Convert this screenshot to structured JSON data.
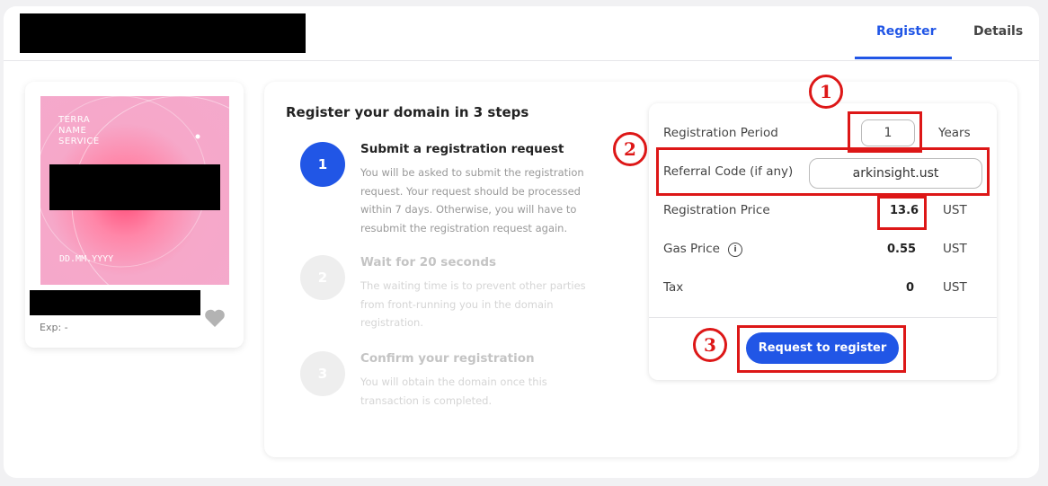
{
  "tabs": {
    "register": "Register",
    "details": "Details"
  },
  "nft": {
    "brand_line1": "TERRA",
    "brand_line2": "NAME",
    "brand_line3": "SERVICE",
    "date_placeholder": "DD.MM.YYYY",
    "exp": "Exp: -",
    "colors": {
      "art_center": "#ff4f7a",
      "art_edge": "#f4a9cc"
    }
  },
  "steps": {
    "title": "Register your domain in 3 steps",
    "items": [
      {
        "number": "1",
        "title": "Submit a registration request",
        "desc": "You will be asked to submit the registration request. Your request should be processed within 7 days. Otherwise, you will have to resubmit the registration request again."
      },
      {
        "number": "2",
        "title": "Wait for 20 seconds",
        "desc": "The waiting time is to prevent other parties from front-running you in the domain registration."
      },
      {
        "number": "3",
        "title": "Confirm your registration",
        "desc": "You will obtain the domain once this transaction is completed."
      }
    ]
  },
  "form": {
    "period_label": "Registration Period",
    "period_value": "1",
    "period_unit": "Years",
    "referral_label": "Referral Code (if any)",
    "referral_value": "arkinsight.ust",
    "price_label": "Registration Price",
    "price_value": "13.6",
    "price_unit": "UST",
    "gas_label": "Gas Price",
    "gas_value": "0.55",
    "gas_unit": "UST",
    "tax_label": "Tax",
    "tax_value": "0",
    "tax_unit": "UST",
    "submit_label": "Request to register"
  },
  "annotations": {
    "one": "1",
    "two": "2",
    "three": "3"
  },
  "colors": {
    "accent": "#2156e6",
    "annotation_red": "#dd1717"
  }
}
